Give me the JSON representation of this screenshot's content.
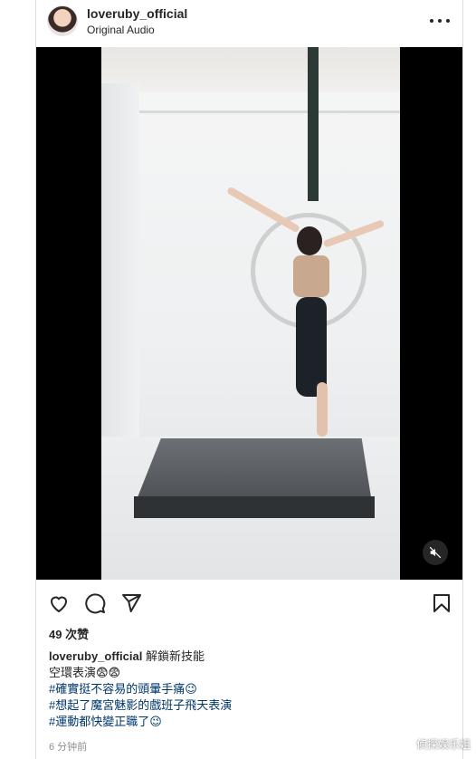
{
  "post": {
    "username": "loveruby_official",
    "audio": "Original Audio",
    "likes": "49 次赞",
    "time": "6 分钟前"
  },
  "caption": {
    "user": "loveruby_official",
    "text": "解鎖新技能",
    "line1": "空環表演😨😨",
    "tag1": "#確實挺不容易的頭暈手痛😉",
    "tag2": "#想起了魔宮魅影的戲班子飛天表演",
    "tag3": "#運動都快變正職了😉"
  },
  "watermark": "侦探娱乐姐",
  "colors": {
    "text": "#262626",
    "hashtag": "#00376b",
    "muted": "#8e8e8e",
    "border": "#dbdbdb"
  },
  "icons": {
    "like": "heart-icon",
    "comment": "comment-icon",
    "share": "send-icon",
    "save": "bookmark-icon",
    "mute": "muted-speaker-icon",
    "more": "more-options-icon"
  }
}
